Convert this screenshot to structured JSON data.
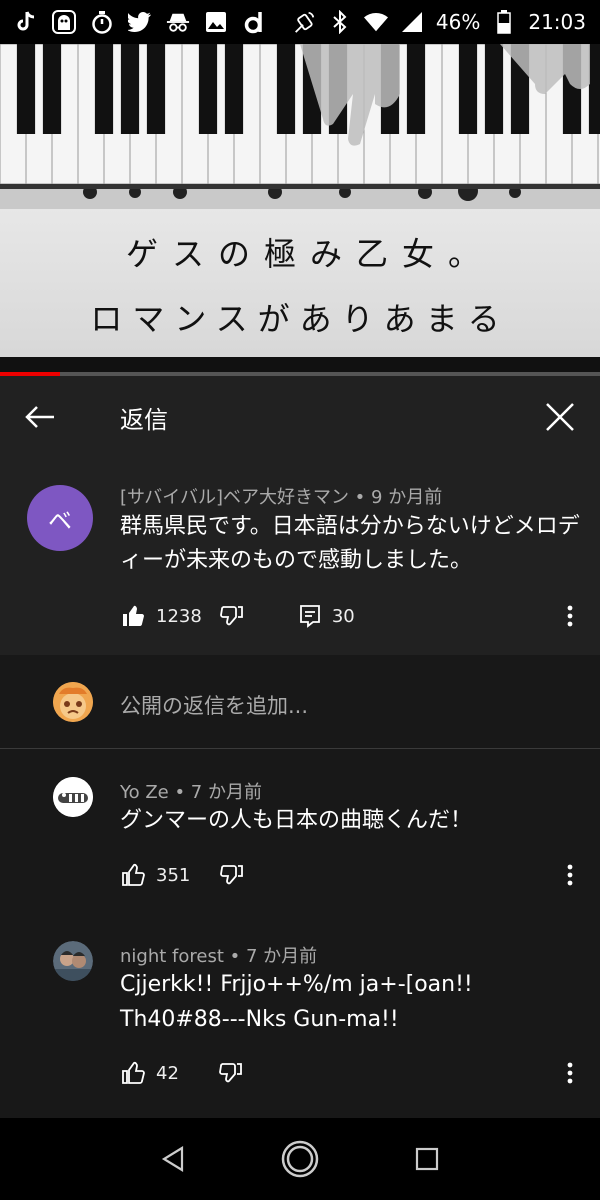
{
  "status_bar": {
    "battery": "46%",
    "time": "21:03",
    "icons": [
      "tiktok-icon",
      "ghost-app-icon",
      "stopwatch-icon",
      "twitter-icon",
      "incognito-icon",
      "gallery-icon",
      "d-app-icon",
      "nfc-icon",
      "bluetooth-icon",
      "wifi-icon",
      "signal-icon",
      "battery-icon"
    ]
  },
  "video": {
    "line1": "ゲスの極み乙女。",
    "line2": "ロマンスがありあまる",
    "progress": 0.1
  },
  "header": {
    "title": "返信",
    "back_icon": "arrow-left-icon",
    "close_icon": "close-icon"
  },
  "top_comment": {
    "avatar_letter": "ベ",
    "avatar_color": "#7e57c2",
    "meta": "[サバイバル]ベア大好きマン • 9 か月前",
    "text": "群馬県民です。日本語は分からないけどメロディーが未来のもので感動しました。",
    "likes": "1238",
    "replies": "30"
  },
  "add_reply": {
    "placeholder": "公開の返信を追加..."
  },
  "replies": [
    {
      "meta": "Yo Ze • 7 か月前",
      "text": "グンマーの人も日本の曲聴くんだ！",
      "likes": "351"
    },
    {
      "meta": "night forest • 7 か月前",
      "text_line1": "Cjjerkk!! Frjjo++%/m ja+-[oan!!",
      "text_line2": "Th40#88---Nks Gun-ma!!",
      "likes": "42"
    }
  ],
  "navbar": {
    "icons": [
      "back-triangle-icon",
      "home-circle-icon",
      "recents-square-icon"
    ]
  }
}
